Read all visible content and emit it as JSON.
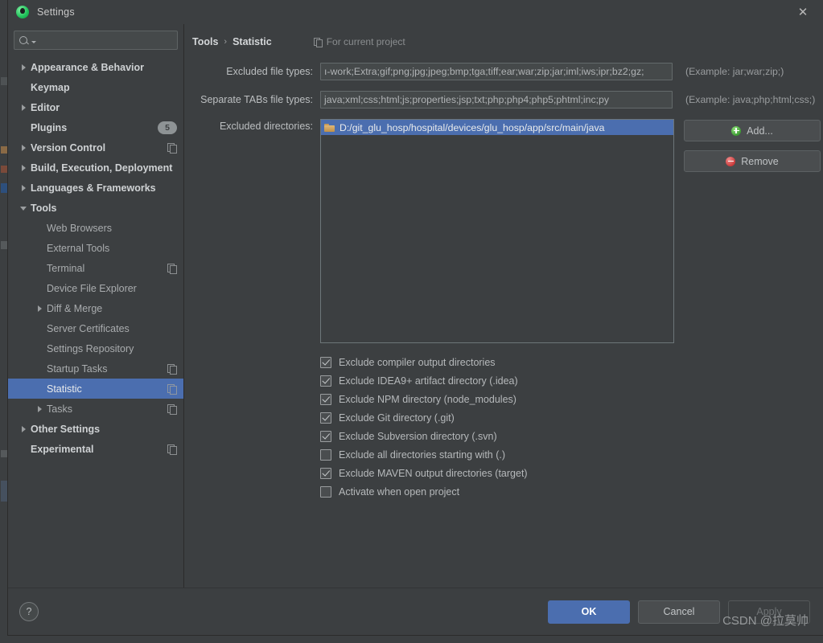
{
  "window": {
    "title": "Settings",
    "app_icon": "android-studio-icon",
    "close_label": "✕"
  },
  "sidebar": {
    "search": {
      "placeholder": "",
      "value": "",
      "icon": "search-icon"
    },
    "items": [
      {
        "label": "Appearance & Behavior",
        "arrow": "closed",
        "level": 0,
        "bold": true
      },
      {
        "label": "Keymap",
        "arrow": "none",
        "level": 0,
        "bold": true
      },
      {
        "label": "Editor",
        "arrow": "closed",
        "level": 0,
        "bold": true
      },
      {
        "label": "Plugins",
        "arrow": "none",
        "level": 0,
        "bold": true,
        "badge": "5"
      },
      {
        "label": "Version Control",
        "arrow": "closed",
        "level": 0,
        "bold": true,
        "copy": true
      },
      {
        "label": "Build, Execution, Deployment",
        "arrow": "closed",
        "level": 0,
        "bold": true
      },
      {
        "label": "Languages & Frameworks",
        "arrow": "closed",
        "level": 0,
        "bold": true
      },
      {
        "label": "Tools",
        "arrow": "open",
        "level": 0,
        "bold": true
      },
      {
        "label": "Web Browsers",
        "arrow": "none",
        "level": 1,
        "bold": false
      },
      {
        "label": "External Tools",
        "arrow": "none",
        "level": 1,
        "bold": false
      },
      {
        "label": "Terminal",
        "arrow": "none",
        "level": 1,
        "bold": false,
        "copy": true
      },
      {
        "label": "Device File Explorer",
        "arrow": "none",
        "level": 1,
        "bold": false
      },
      {
        "label": "Diff & Merge",
        "arrow": "closed",
        "level": 1,
        "bold": false
      },
      {
        "label": "Server Certificates",
        "arrow": "none",
        "level": 1,
        "bold": false
      },
      {
        "label": "Settings Repository",
        "arrow": "none",
        "level": 1,
        "bold": false
      },
      {
        "label": "Startup Tasks",
        "arrow": "none",
        "level": 1,
        "bold": false,
        "copy": true
      },
      {
        "label": "Statistic",
        "arrow": "none",
        "level": 1,
        "bold": false,
        "copy": true,
        "selected": true
      },
      {
        "label": "Tasks",
        "arrow": "closed",
        "level": 1,
        "bold": false,
        "copy": true
      },
      {
        "label": "Other Settings",
        "arrow": "closed",
        "level": 0,
        "bold": true
      },
      {
        "label": "Experimental",
        "arrow": "none",
        "level": 0,
        "bold": true,
        "copy": true
      }
    ]
  },
  "content": {
    "breadcrumb": {
      "parent": "Tools",
      "separator": "›",
      "current": "Statistic"
    },
    "scope_note": {
      "icon": "copy-scope-icon",
      "text": "For current project"
    },
    "fields": [
      {
        "label": "Excluded file types:",
        "value": "ı-work;Extra;gif;png;jpg;jpeg;bmp;tga;tiff;ear;war;zip;jar;iml;iws;ipr;bz2;gz;",
        "hint": "(Example: jar;war;zip;)"
      },
      {
        "label": "Separate TABs file types:",
        "value": "java;xml;css;html;js;properties;jsp;txt;php;php4;php5;phtml;inc;py",
        "hint": "(Example: java;php;html;css;)"
      }
    ],
    "directories": {
      "label": "Excluded directories:",
      "items": [
        {
          "path": "D:/git_glu_hosp/hospital/devices/glu_hosp/app/src/main/java",
          "selected": true
        }
      ],
      "buttons": [
        {
          "label": "Add...",
          "icon": "add-circle-icon"
        },
        {
          "label": "Remove",
          "icon": "remove-circle-icon"
        }
      ]
    },
    "checkboxes": [
      {
        "label": "Exclude compiler output directories",
        "checked": true
      },
      {
        "label": "Exclude IDEA9+ artifact directory (.idea)",
        "checked": true
      },
      {
        "label": "Exclude NPM directory (node_modules)",
        "checked": true
      },
      {
        "label": "Exclude Git directory (.git)",
        "checked": true
      },
      {
        "label": "Exclude Subversion directory (.svn)",
        "checked": true
      },
      {
        "label": "Exclude all directories starting with (.)",
        "checked": false
      },
      {
        "label": "Exclude MAVEN output directories (target)",
        "checked": true
      },
      {
        "label": "Activate when open project",
        "checked": false
      }
    ]
  },
  "footer": {
    "help_label": "?",
    "ok_label": "OK",
    "cancel_label": "Cancel",
    "apply_label": "Apply"
  },
  "watermark": "CSDN @拉莫帅",
  "colors": {
    "accent": "#4b6eaf",
    "dialog_bg": "#3c3f41",
    "input_bg": "#45494a",
    "text": "#bbbbbb"
  }
}
